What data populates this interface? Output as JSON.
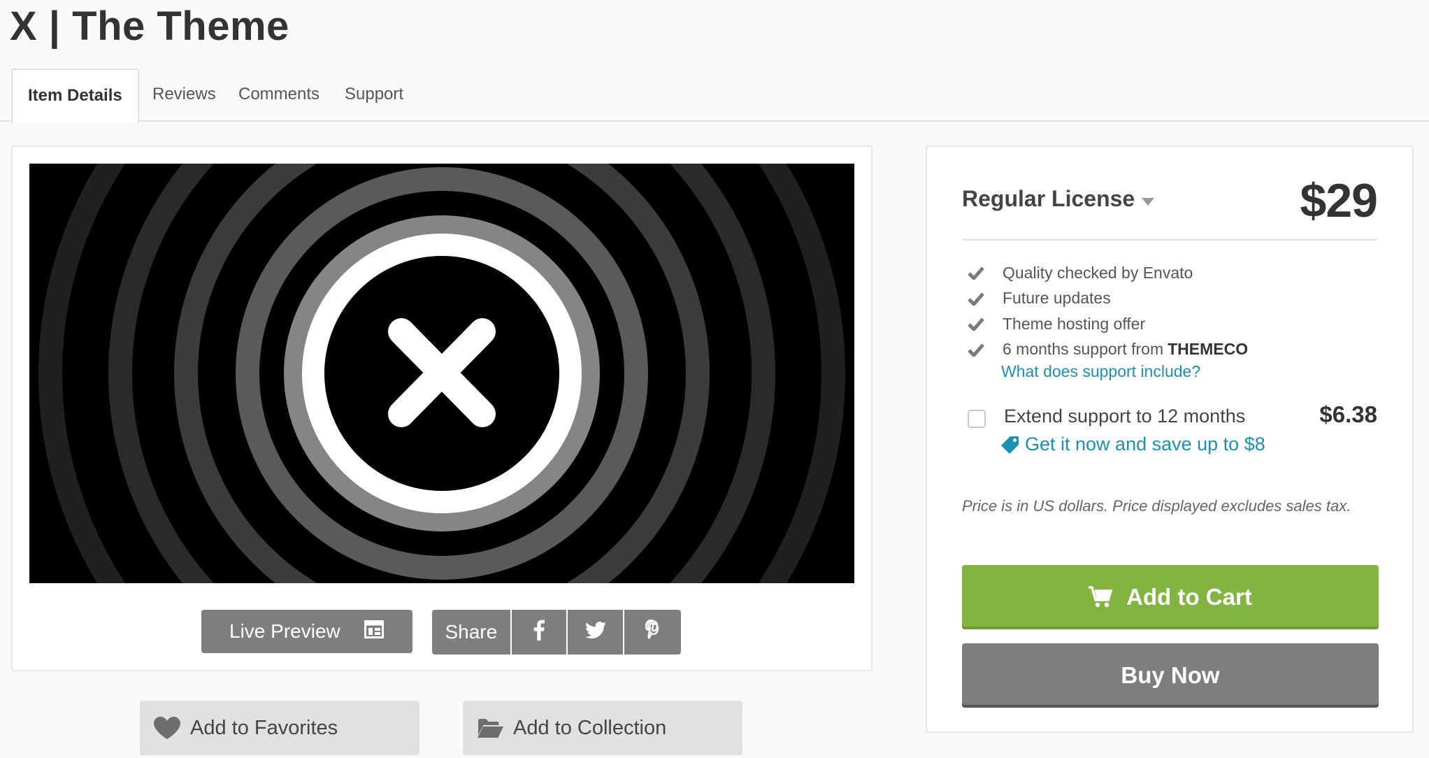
{
  "page": {
    "title": "X | The Theme"
  },
  "tabs": [
    {
      "label": "Item Details",
      "active": true
    },
    {
      "label": "Reviews",
      "active": false
    },
    {
      "label": "Comments",
      "active": false
    },
    {
      "label": "Support",
      "active": false
    }
  ],
  "preview": {
    "live_preview_label": "Live Preview",
    "share_label": "Share",
    "share_icons": [
      "facebook-icon",
      "twitter-icon",
      "pinterest-icon"
    ]
  },
  "actions": {
    "favorites_label": "Add to Favorites",
    "collection_label": "Add to Collection"
  },
  "license": {
    "name": "Regular License",
    "price": "$29",
    "features": [
      {
        "text": "Quality checked by Envato",
        "strong": ""
      },
      {
        "text": "Future updates",
        "strong": ""
      },
      {
        "text": "Theme hosting offer",
        "strong": ""
      },
      {
        "text": "6 months support from",
        "strong": "THEMECO"
      }
    ],
    "support_link": "What does support include?",
    "extend_label": "Extend support to 12 months",
    "extend_price": "$6.38",
    "extend_checked": false,
    "save_link": "Get it now and save up to $8",
    "price_note": "Price is in US dollars. Price displayed excludes sales tax.",
    "add_to_cart_label": "Add to Cart",
    "buy_now_label": "Buy Now"
  },
  "colors": {
    "accent_green": "#82b440",
    "link_blue": "#1a90b5",
    "button_grey": "#7e7e7e"
  }
}
